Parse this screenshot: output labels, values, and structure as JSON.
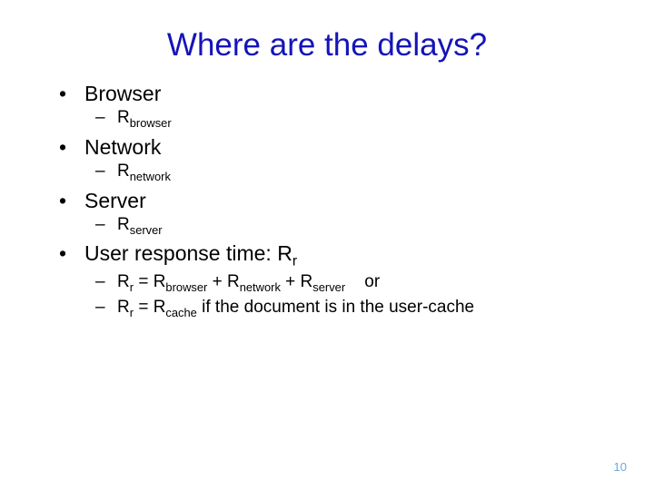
{
  "title": "Where are the delays?",
  "items": [
    {
      "level": 1,
      "html": "Browser"
    },
    {
      "level": 2,
      "html": "R<sub>browser</sub>"
    },
    {
      "level": 1,
      "html": "Network"
    },
    {
      "level": 2,
      "html": "R<sub>network</sub>"
    },
    {
      "level": 1,
      "html": "Server"
    },
    {
      "level": 2,
      "html": "R<sub>server</sub>"
    },
    {
      "level": 1,
      "html": "User response time: R<sub>r</sub>"
    },
    {
      "level": 2,
      "html": "R<sub>r</sub> = R<sub>browser</sub> + R<sub>network</sub> + R<sub>server</sub>&nbsp;&nbsp;&nbsp;&nbsp;or"
    },
    {
      "level": 2,
      "html": "R<sub>r</sub> = R<sub>cache</sub> if the document is in the user-cache"
    }
  ],
  "pagenum": "10"
}
